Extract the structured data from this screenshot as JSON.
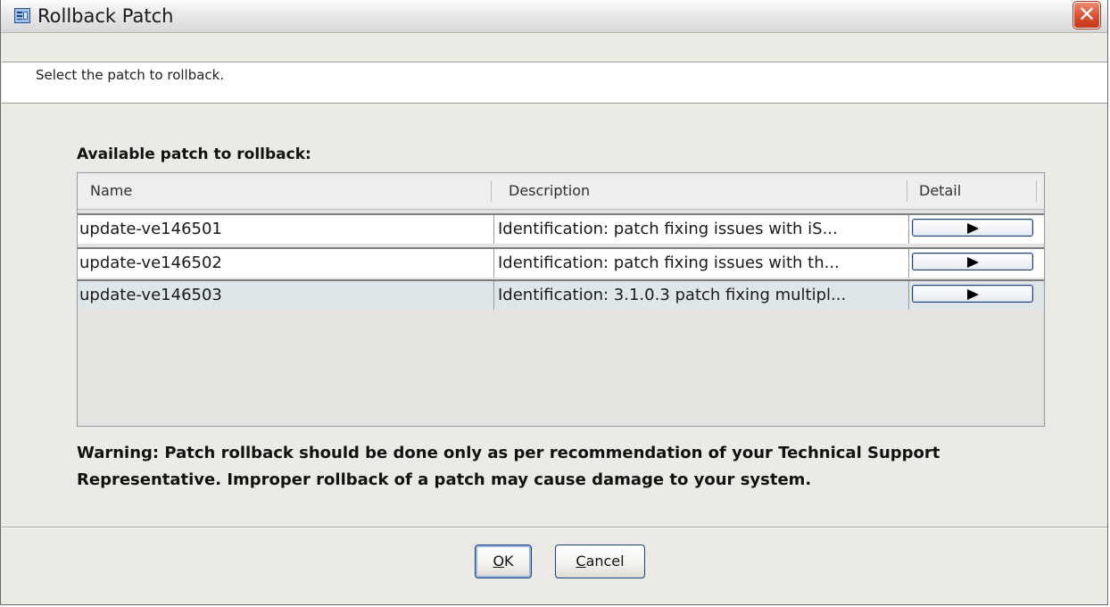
{
  "window": {
    "title": "Rollback Patch",
    "close_glyph": "✕",
    "icon": "app-window-icon"
  },
  "header": {
    "message": "Select the patch to rollback."
  },
  "patches": {
    "label": "Available patch to rollback:",
    "columns": [
      "Name",
      "Description",
      "Detail"
    ],
    "rows": [
      {
        "name": "update-ve146501",
        "description": "Identification: patch fixing issues with iS..."
      },
      {
        "name": "update-ve146502",
        "description": "Identification: patch fixing issues with th..."
      },
      {
        "name": "update-ve146503",
        "description": "Identification: 3.1.0.3 patch fixing multipl..."
      }
    ],
    "selected_row": 2
  },
  "warning": {
    "line1": "Warning: Patch rollback should be done only as per recommendation of your Technical Support",
    "line2": "Representative. Improper rollback of a patch may cause damage to your system."
  },
  "buttons": {
    "ok": {
      "mnemonic": "O",
      "rest": "K"
    },
    "cancel": {
      "mnemonic": "C",
      "rest": "ancel"
    }
  }
}
